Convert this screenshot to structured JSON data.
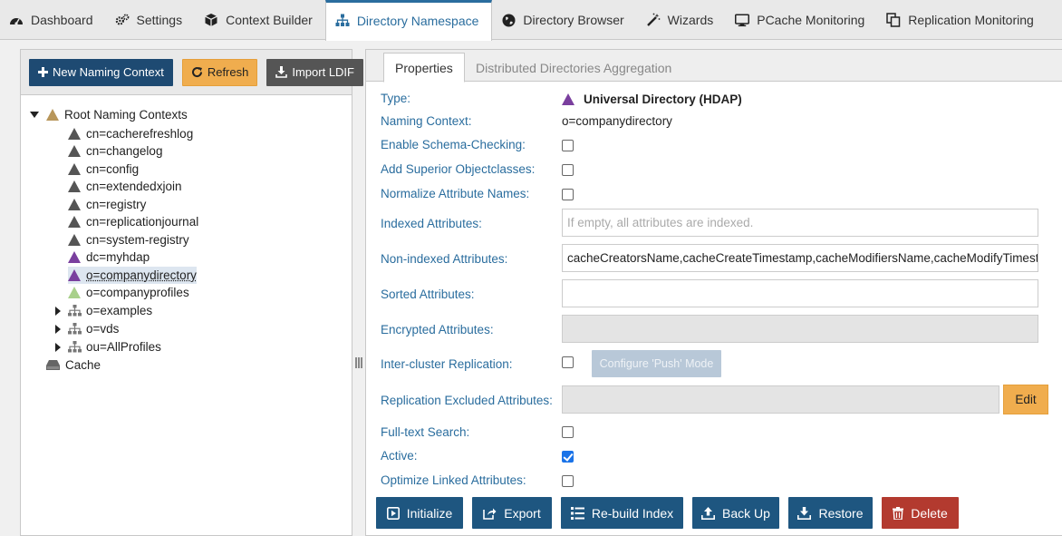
{
  "top_tabs": [
    {
      "label": "Dashboard",
      "icon": "dashboard-icon"
    },
    {
      "label": "Settings",
      "icon": "gears-icon"
    },
    {
      "label": "Context Builder",
      "icon": "cube-icon"
    },
    {
      "label": "Directory Namespace",
      "icon": "sitemap-icon",
      "active": true
    },
    {
      "label": "Directory Browser",
      "icon": "globe-icon"
    },
    {
      "label": "Wizards",
      "icon": "magic-wand-icon"
    },
    {
      "label": "PCache Monitoring",
      "icon": "monitor-icon"
    },
    {
      "label": "Replication Monitoring",
      "icon": "copy-icon"
    }
  ],
  "left_toolbar": {
    "new_naming_context": "New Naming Context",
    "refresh": "Refresh",
    "import_ldif": "Import LDIF"
  },
  "tree": {
    "root": "Root Naming Contexts",
    "items": [
      "cn=cacherefreshlog",
      "cn=changelog",
      "cn=config",
      "cn=extendedxjoin",
      "cn=registry",
      "cn=replicationjournal",
      "cn=system-registry",
      "dc=myhdap",
      "o=companydirectory",
      "o=companyprofiles",
      "o=examples",
      "o=vds",
      "ou=AllProfiles"
    ],
    "cache": "Cache"
  },
  "right_tabs": {
    "properties": "Properties",
    "distributed": "Distributed Directories Aggregation"
  },
  "form": {
    "type_label": "Type:",
    "type_value": "Universal Directory (HDAP)",
    "naming_context_label": "Naming Context:",
    "naming_context_value": "o=companydirectory",
    "schema_checking_label": "Enable Schema-Checking:",
    "add_superior_label": "Add Superior Objectclasses:",
    "normalize_label": "Normalize Attribute Names:",
    "indexed_label": "Indexed Attributes:",
    "indexed_placeholder": "If empty, all attributes are indexed.",
    "nonindexed_label": "Non-indexed Attributes:",
    "nonindexed_value": "cacheCreatorsName,cacheCreateTimestamp,cacheModifiersName,cacheModifyTimestamp",
    "sorted_label": "Sorted Attributes:",
    "encrypted_label": "Encrypted Attributes:",
    "intercluster_label": "Inter-cluster Replication:",
    "configure_push": "Configure 'Push' Mode",
    "repl_excluded_label": "Replication Excluded Attributes:",
    "edit": "Edit",
    "fulltext_label": "Full-text Search:",
    "active_label": "Active:",
    "optimize_label": "Optimize Linked Attributes:"
  },
  "actions": {
    "initialize": "Initialize",
    "export": "Export",
    "rebuild_index": "Re-build Index",
    "back_up": "Back Up",
    "restore": "Restore",
    "delete": "Delete"
  },
  "colors": {
    "accent": "#2a6d9e",
    "navy_button": "#1e4a72",
    "action_button": "#1e5680",
    "orange_button": "#f0ad4e",
    "delete_button": "#b33a2f",
    "hdap_purple": "#7a3f9e"
  }
}
